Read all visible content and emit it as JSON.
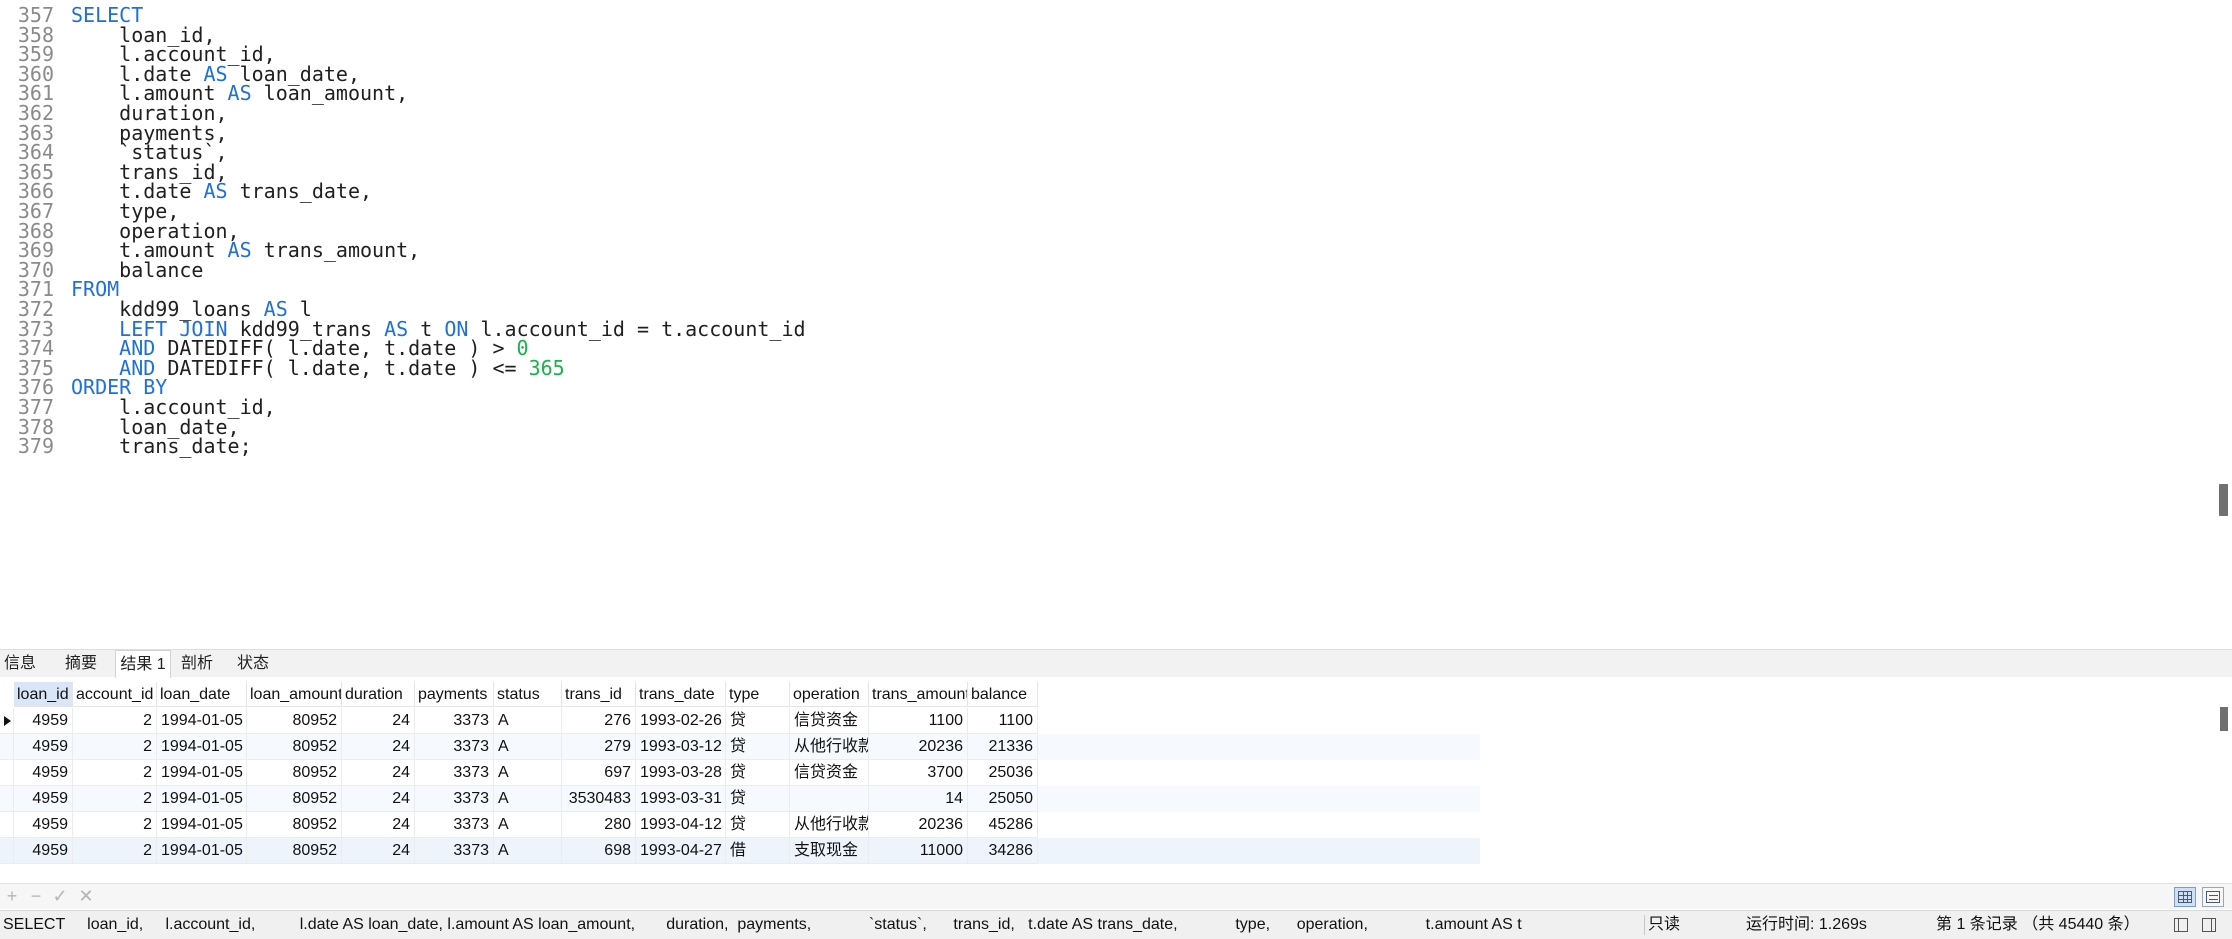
{
  "editor": {
    "lines": [
      {
        "num": "357",
        "tokens": [
          {
            "t": "SELECT",
            "c": "kw"
          }
        ]
      },
      {
        "num": "358",
        "tokens": [
          {
            "t": "    loan_id,",
            "c": ""
          }
        ]
      },
      {
        "num": "359",
        "tokens": [
          {
            "t": "    l.account_id,",
            "c": ""
          }
        ]
      },
      {
        "num": "360",
        "tokens": [
          {
            "t": "    l.date ",
            "c": ""
          },
          {
            "t": "AS",
            "c": "kw"
          },
          {
            "t": " loan_date,",
            "c": ""
          }
        ]
      },
      {
        "num": "361",
        "tokens": [
          {
            "t": "    l.amount ",
            "c": ""
          },
          {
            "t": "AS",
            "c": "kw"
          },
          {
            "t": " loan_amount,",
            "c": ""
          }
        ]
      },
      {
        "num": "362",
        "tokens": [
          {
            "t": "    duration,",
            "c": ""
          }
        ]
      },
      {
        "num": "363",
        "tokens": [
          {
            "t": "    payments,",
            "c": ""
          }
        ]
      },
      {
        "num": "364",
        "tokens": [
          {
            "t": "    `status`,",
            "c": ""
          }
        ]
      },
      {
        "num": "365",
        "tokens": [
          {
            "t": "    trans_id,",
            "c": ""
          }
        ]
      },
      {
        "num": "366",
        "tokens": [
          {
            "t": "    t.date ",
            "c": ""
          },
          {
            "t": "AS",
            "c": "kw"
          },
          {
            "t": " trans_date,",
            "c": ""
          }
        ]
      },
      {
        "num": "367",
        "tokens": [
          {
            "t": "    type,",
            "c": ""
          }
        ]
      },
      {
        "num": "368",
        "tokens": [
          {
            "t": "    operation,",
            "c": ""
          }
        ]
      },
      {
        "num": "369",
        "tokens": [
          {
            "t": "    t.amount ",
            "c": ""
          },
          {
            "t": "AS",
            "c": "kw"
          },
          {
            "t": " trans_amount,",
            "c": ""
          }
        ]
      },
      {
        "num": "370",
        "tokens": [
          {
            "t": "    balance",
            "c": ""
          }
        ]
      },
      {
        "num": "371",
        "tokens": [
          {
            "t": "FROM",
            "c": "kw"
          }
        ]
      },
      {
        "num": "372",
        "tokens": [
          {
            "t": "    kdd99_loans ",
            "c": ""
          },
          {
            "t": "AS",
            "c": "kw"
          },
          {
            "t": " l",
            "c": ""
          }
        ]
      },
      {
        "num": "373",
        "tokens": [
          {
            "t": "    ",
            "c": ""
          },
          {
            "t": "LEFT JOIN",
            "c": "kw"
          },
          {
            "t": " kdd99_trans ",
            "c": ""
          },
          {
            "t": "AS",
            "c": "kw"
          },
          {
            "t": " t ",
            "c": ""
          },
          {
            "t": "ON",
            "c": "kw"
          },
          {
            "t": " l.account_id = t.account_id",
            "c": ""
          }
        ]
      },
      {
        "num": "374",
        "tokens": [
          {
            "t": "    ",
            "c": ""
          },
          {
            "t": "AND",
            "c": "kw"
          },
          {
            "t": " DATEDIFF( l.date, t.date ) > ",
            "c": ""
          },
          {
            "t": "0",
            "c": "num"
          }
        ]
      },
      {
        "num": "375",
        "tokens": [
          {
            "t": "    ",
            "c": ""
          },
          {
            "t": "AND",
            "c": "kw"
          },
          {
            "t": " DATEDIFF( l.date, t.date ) <= ",
            "c": ""
          },
          {
            "t": "365",
            "c": "num"
          }
        ]
      },
      {
        "num": "376",
        "tokens": [
          {
            "t": "ORDER BY",
            "c": "kw"
          }
        ]
      },
      {
        "num": "377",
        "tokens": [
          {
            "t": "    l.account_id,",
            "c": ""
          }
        ]
      },
      {
        "num": "378",
        "tokens": [
          {
            "t": "    loan_date,",
            "c": ""
          }
        ]
      },
      {
        "num": "379",
        "tokens": [
          {
            "t": "    trans_date;",
            "c": ""
          }
        ]
      }
    ]
  },
  "tabs": [
    {
      "label": "信息",
      "active": false
    },
    {
      "label": "摘要",
      "active": false
    },
    {
      "label": "结果 1",
      "active": true
    },
    {
      "label": "剖析",
      "active": false
    },
    {
      "label": "状态",
      "active": false
    }
  ],
  "grid": {
    "columns": [
      "loan_id",
      "account_id",
      "loan_date",
      "loan_amount",
      "duration",
      "payments",
      "status",
      "trans_id",
      "trans_date",
      "type",
      "operation",
      "trans_amount",
      "balance"
    ],
    "rows": [
      [
        "4959",
        "2",
        "1994-01-05",
        "80952",
        "24",
        "3373",
        "A",
        "276",
        "1993-02-26",
        "贷",
        "信贷资金",
        "1100",
        "1100"
      ],
      [
        "4959",
        "2",
        "1994-01-05",
        "80952",
        "24",
        "3373",
        "A",
        "279",
        "1993-03-12",
        "贷",
        "从他行收款",
        "20236",
        "21336"
      ],
      [
        "4959",
        "2",
        "1994-01-05",
        "80952",
        "24",
        "3373",
        "A",
        "697",
        "1993-03-28",
        "贷",
        "信贷资金",
        "3700",
        "25036"
      ],
      [
        "4959",
        "2",
        "1994-01-05",
        "80952",
        "24",
        "3373",
        "A",
        "3530483",
        "1993-03-31",
        "贷",
        "",
        "14",
        "25050"
      ],
      [
        "4959",
        "2",
        "1994-01-05",
        "80952",
        "24",
        "3373",
        "A",
        "280",
        "1993-04-12",
        "贷",
        "从他行收款",
        "20236",
        "45286"
      ],
      [
        "4959",
        "2",
        "1994-01-05",
        "80952",
        "24",
        "3373",
        "A",
        "698",
        "1993-04-27",
        "借",
        "支取现金",
        "11000",
        "34286"
      ]
    ]
  },
  "toolbar": {
    "icons": [
      {
        "name": "add-record-icon",
        "glyph": "+"
      },
      {
        "name": "delete-record-icon",
        "glyph": "−"
      },
      {
        "name": "apply-changes-icon",
        "glyph": "✓"
      },
      {
        "name": "discard-changes-icon",
        "glyph": "✕"
      }
    ]
  },
  "status": {
    "sql": "SELECT     loan_id,     l.account_id,          l.date AS loan_date, l.amount AS loan_amount,       duration,  payments,             `status`,      trans_id,   t.date AS trans_date,             type,      operation,             t.amount AS t",
    "readonly": "只读",
    "runtime": "运行时间: 1.269s",
    "records": "第 1 条记录 （共 45440 条）"
  }
}
